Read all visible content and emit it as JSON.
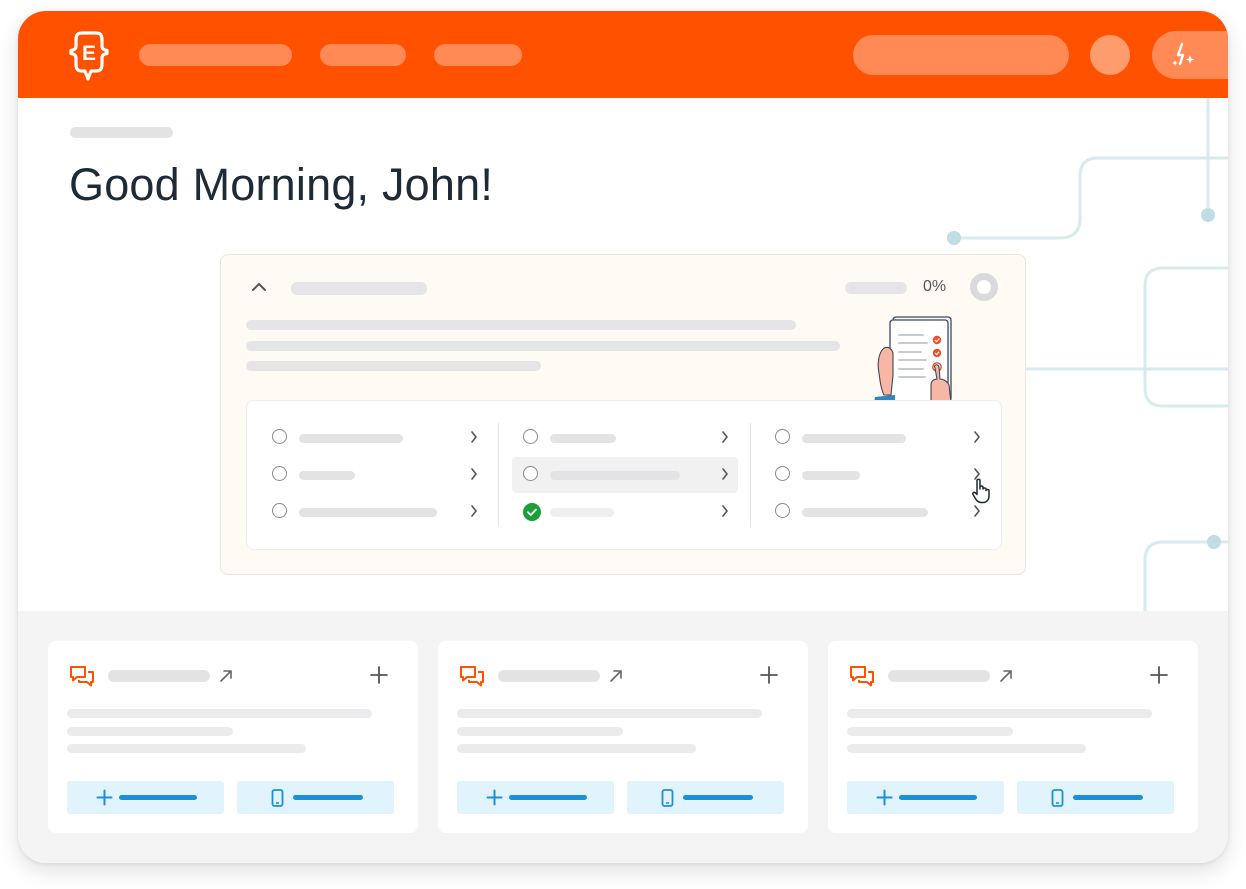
{
  "header": {
    "logo_letter": "E",
    "brand_color": "#FF5100",
    "ai_icon": "sparkle-bolt-icon"
  },
  "greeting": {
    "text": "Good Morning, John!"
  },
  "onboarding": {
    "progress_text": "0%",
    "progress_value": 0,
    "collapse_icon": "chevron-up-icon",
    "illustration": "checklist-clipboard-illustration",
    "task_columns": [
      {
        "tasks": [
          {
            "completed": false
          },
          {
            "completed": false
          },
          {
            "completed": false
          }
        ]
      },
      {
        "tasks": [
          {
            "completed": false
          },
          {
            "completed": false,
            "hovered": true
          },
          {
            "completed": true
          }
        ]
      },
      {
        "tasks": [
          {
            "completed": false
          },
          {
            "completed": false
          },
          {
            "completed": false
          }
        ]
      }
    ],
    "success_color": "#1E9E3A"
  },
  "cards": [
    {
      "icon": "chat-bubbles-icon",
      "primary_action_icon": "plus-icon",
      "secondary_action_icon": "phone-icon"
    },
    {
      "icon": "chat-bubbles-icon",
      "primary_action_icon": "plus-icon",
      "secondary_action_icon": "phone-icon"
    },
    {
      "icon": "chat-bubbles-icon",
      "primary_action_icon": "plus-icon",
      "secondary_action_icon": "phone-icon"
    }
  ],
  "accent_colors": {
    "card_icon": "#FF5100",
    "action_button_bg": "#E1F3FD",
    "action_button_fg": "#1A90D9"
  }
}
